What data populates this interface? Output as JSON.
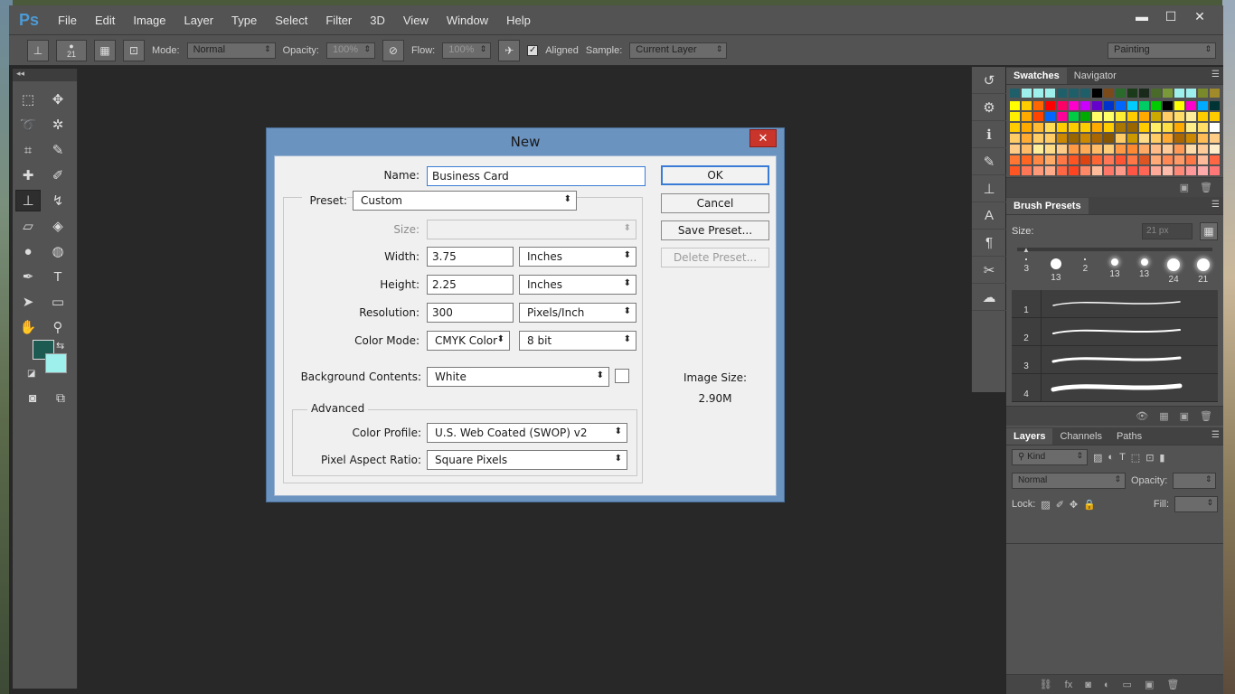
{
  "app": {
    "logo": "Ps",
    "menu": [
      "File",
      "Edit",
      "Image",
      "Layer",
      "Type",
      "Select",
      "Filter",
      "3D",
      "View",
      "Window",
      "Help"
    ],
    "window_buttons": [
      "▬",
      "☐",
      "✕"
    ]
  },
  "options_bar": {
    "brush_size": "21",
    "mode_label": "Mode:",
    "mode_value": "Normal",
    "opacity_label": "Opacity:",
    "opacity_value": "100%",
    "flow_label": "Flow:",
    "flow_value": "100%",
    "aligned_label": "Aligned",
    "aligned_checked": true,
    "sample_label": "Sample:",
    "sample_value": "Current Layer",
    "workspace": "Painting"
  },
  "toolbar": {
    "collapse": "◂◂",
    "tools": [
      {
        "icon": "marquee-icon",
        "glyph": "⬚"
      },
      {
        "icon": "move-icon",
        "glyph": "✥"
      },
      {
        "icon": "lasso-icon",
        "glyph": "➰"
      },
      {
        "icon": "magic-wand-icon",
        "glyph": "✲"
      },
      {
        "icon": "crop-icon",
        "glyph": "⌗"
      },
      {
        "icon": "eyedropper-icon",
        "glyph": "✎"
      },
      {
        "icon": "healing-icon",
        "glyph": "✚"
      },
      {
        "icon": "brush-icon",
        "glyph": "✐"
      },
      {
        "icon": "clone-stamp-icon",
        "glyph": "⊥"
      },
      {
        "icon": "history-brush-icon",
        "glyph": "↯"
      },
      {
        "icon": "eraser-icon",
        "glyph": "▱"
      },
      {
        "icon": "paint-bucket-icon",
        "glyph": "◈"
      },
      {
        "icon": "blur-icon",
        "glyph": "●"
      },
      {
        "icon": "dodge-icon",
        "glyph": "◍"
      },
      {
        "icon": "pen-icon",
        "glyph": "✒"
      },
      {
        "icon": "type-icon",
        "glyph": "T"
      },
      {
        "icon": "path-select-icon",
        "glyph": "➤"
      },
      {
        "icon": "rectangle-icon",
        "glyph": "▭"
      },
      {
        "icon": "hand-icon",
        "glyph": "✋"
      },
      {
        "icon": "zoom-icon",
        "glyph": "⚲"
      }
    ],
    "fg_color": "#1c5a52",
    "bg_color": "#9ef0ed"
  },
  "dialog": {
    "title": "New",
    "close": "✕",
    "name_label": "Name:",
    "name_value": "Business Card",
    "preset_label": "Preset:",
    "preset_value": "Custom",
    "size_label": "Size:",
    "width_label": "Width:",
    "width_value": "3.75",
    "width_unit": "Inches",
    "height_label": "Height:",
    "height_value": "2.25",
    "height_unit": "Inches",
    "resolution_label": "Resolution:",
    "resolution_value": "300",
    "resolution_unit": "Pixels/Inch",
    "color_mode_label": "Color Mode:",
    "color_mode_value": "CMYK Color",
    "bit_depth": "8 bit",
    "bg_contents_label": "Background Contents:",
    "bg_contents_value": "White",
    "advanced_label": "Advanced",
    "color_profile_label": "Color Profile:",
    "color_profile_value": "U.S. Web Coated (SWOP) v2",
    "pixel_aspect_label": "Pixel Aspect Ratio:",
    "pixel_aspect_value": "Square Pixels",
    "buttons": {
      "ok": "OK",
      "cancel": "Cancel",
      "save_preset": "Save Preset...",
      "delete_preset": "Delete Preset..."
    },
    "image_size_label": "Image Size:",
    "image_size_value": "2.90M"
  },
  "panels": {
    "swatches_tabs": [
      "Swatches",
      "Navigator"
    ],
    "brush_presets_tab": "Brush Presets",
    "size_label": "Size:",
    "size_value": "21 px",
    "brush_tips": [
      "3",
      "13",
      "2",
      "13",
      "13",
      "24",
      "21"
    ],
    "strokes": [
      "1",
      "2",
      "3",
      "4"
    ],
    "layers_tabs": [
      "Layers",
      "Channels",
      "Paths"
    ],
    "kind_label": "Kind",
    "blend_mode": "Normal",
    "opacity_label": "Opacity:",
    "lock_label": "Lock:",
    "fill_label": "Fill:",
    "panel_menu": "☰"
  },
  "swatch_colors": {
    "recent": [
      "#1f5f6a",
      "#9ef0ed",
      "#9ef0ed",
      "#9ef0ed",
      "#1f5f6a",
      "#1f5f6a",
      "#1f5f6a",
      "#000000",
      "#7a4a1a",
      "#2a6a2a",
      "#1a3a1a",
      "#1a2a1a",
      "#4a6a2a",
      "#7a9a3a",
      "#9ef0ed",
      "#9ef0ed",
      "#7a8a2a",
      "#a08a2a"
    ],
    "rows": [
      [
        "#ffff00",
        "#ffcc00",
        "#ff6600",
        "#ff0000",
        "#ff0066",
        "#ff00cc",
        "#cc00ff",
        "#6600cc",
        "#0033cc",
        "#0066ff",
        "#00ccff",
        "#00cc66",
        "#00cc00",
        "#000000",
        "#ffff00",
        "#ff00cc",
        "#00aaff",
        "#003333"
      ],
      [
        "#ffee00",
        "#ffaa00",
        "#ff4400",
        "#0066ff",
        "#ff0099",
        "#00cc44",
        "#00aa00",
        "#ffff66",
        "#ffff66",
        "#ffee33",
        "#ffcc00",
        "#ffaa00",
        "#ccaa00",
        "#ffcc66",
        "#ffdd66",
        "#ffee99",
        "#ffcc00",
        "#ffcc00"
      ],
      [
        "#ffcc00",
        "#ffaa00",
        "#ffbb33",
        "#ffdd55",
        "#ffcc00",
        "#ffcc00",
        "#ffcc00",
        "#ffaa00",
        "#ffcc00",
        "#aa7700",
        "#996600",
        "#ffcc00",
        "#ffee66",
        "#ffdd44",
        "#ffaa00",
        "#ffee88",
        "#ffdd66",
        "#ffffff"
      ],
      [
        "#ffcc66",
        "#ffaa33",
        "#ffcc66",
        "#ffcc66",
        "#cc8800",
        "#996600",
        "#cc8800",
        "#aa6600",
        "#885500",
        "#ffcc66",
        "#cc9900",
        "#ffdd88",
        "#ffcc66",
        "#ffaa33",
        "#aa6600",
        "#cc8800",
        "#ffbb55",
        "#ffcc88"
      ],
      [
        "#ffcc88",
        "#ffbb66",
        "#ffee99",
        "#ffdd88",
        "#ffcc88",
        "#ff9944",
        "#ffaa55",
        "#ffbb66",
        "#ffcc77",
        "#ff9944",
        "#ff8833",
        "#ffaa66",
        "#ffbb88",
        "#ffcc99",
        "#ff9955",
        "#ffddaa",
        "#ffcc99",
        "#ffeecc"
      ],
      [
        "#ff7733",
        "#ff6622",
        "#ff8844",
        "#ffaa66",
        "#ff7744",
        "#ff5522",
        "#dd4411",
        "#ff6633",
        "#ff7755",
        "#ff5533",
        "#ff7744",
        "#dd5522",
        "#ffaa77",
        "#ff8855",
        "#ff9966",
        "#ff7744",
        "#ffbb99",
        "#ff6644"
      ],
      [
        "#ff5522",
        "#ff7755",
        "#ff9977",
        "#ffaa88",
        "#ff6644",
        "#ff4422",
        "#ff8866",
        "#ffbb99",
        "#ff7766",
        "#ff9988",
        "#ff5544",
        "#ff6655",
        "#ffaa99",
        "#ffbbaa",
        "#ff8877",
        "#ff9999",
        "#ffaaaa",
        "#ff7777"
      ]
    ]
  }
}
